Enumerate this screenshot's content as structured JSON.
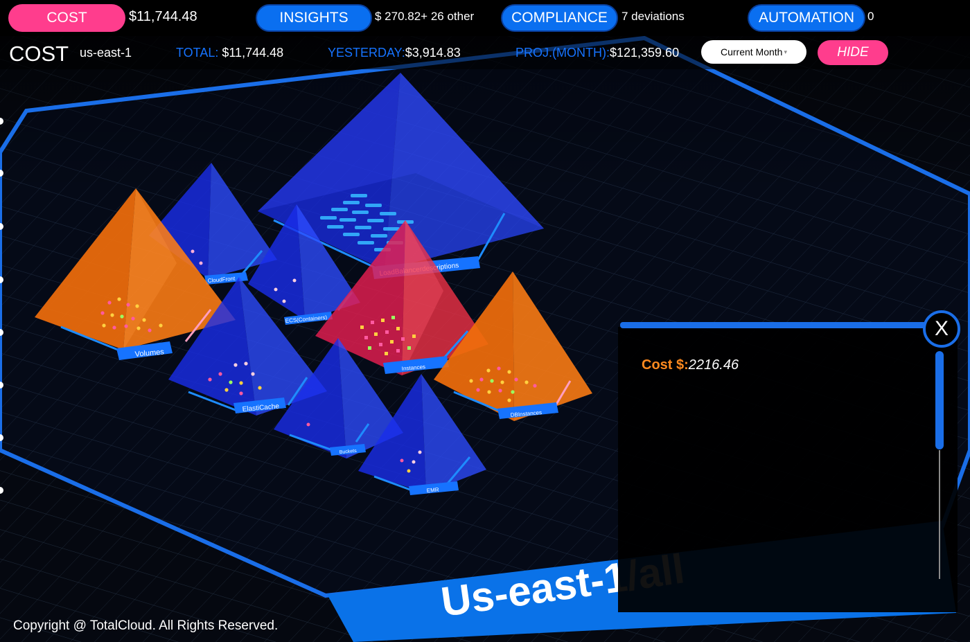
{
  "topbar": {
    "cost": {
      "label": "COST",
      "value": "$11,744.48"
    },
    "insights": {
      "label": "INSIGHTS",
      "value": "$ 270.82+ 26 other"
    },
    "compliance": {
      "label": "COMPLIANCE",
      "value": "7 deviations"
    },
    "automation": {
      "label": "AUTOMATION",
      "value": "0"
    }
  },
  "subbar": {
    "title": "COST",
    "region": "us-east-1",
    "total_label": "TOTAL:",
    "total_value": "$11,744.48",
    "yesterday_label": "YESTERDAY:",
    "yesterday_value": "$3,914.83",
    "proj_label": "PROJ.(MONTH):",
    "proj_value": "$121,359.60",
    "period_select": "Current Month",
    "hide_label": "HIDE"
  },
  "scene": {
    "pyramids": [
      {
        "name": "Volumes",
        "color": "orange"
      },
      {
        "name": "CloudFront",
        "color": "blue"
      },
      {
        "name": "LoadBalancerdescriptions",
        "color": "blue"
      },
      {
        "name": "ECS(Containers)",
        "color": "blue"
      },
      {
        "name": "Instances",
        "color": "red"
      },
      {
        "name": "ElastiCache",
        "color": "blue"
      },
      {
        "name": "Buckets",
        "color": "blue"
      },
      {
        "name": "DBInstances",
        "color": "orange"
      },
      {
        "name": "EMR",
        "color": "blue"
      }
    ],
    "region_banner": "Us-east-1/all"
  },
  "panel": {
    "cost_label": "Cost $:",
    "cost_value": "2216.46",
    "close_label": "X"
  },
  "footer": {
    "copyright": "Copyright @ TotalCloud. All Rights Reserved."
  },
  "colors": {
    "pink": "#ff3d8d",
    "blue": "#0a6ff0",
    "label_blue": "#1673ff",
    "orange": "#ff7a10"
  }
}
